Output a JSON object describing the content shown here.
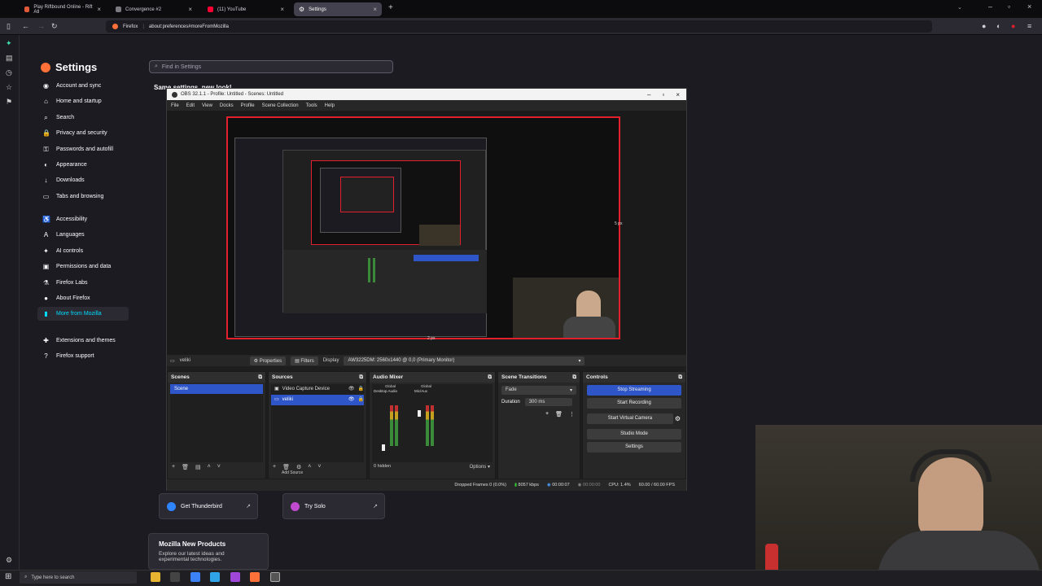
{
  "browser": {
    "tabs": [
      {
        "label": "Play Riftbound Online - Rift Atl",
        "color": "#e05a3a"
      },
      {
        "label": "Convergence #2",
        "color": "#7a7a80"
      },
      {
        "label": "(11) YouTube",
        "color": "#ff0033"
      },
      {
        "label": "Settings",
        "color": "#9a9aa5"
      }
    ],
    "new_tab": "+",
    "url_prefix": "Firefox",
    "url": "about:preferences#moreFromMozilla"
  },
  "settings": {
    "title": "Settings",
    "find_placeholder": "Find in Settings",
    "nav": [
      {
        "label": "Account and sync",
        "icon": "account-icon"
      },
      {
        "label": "Home and startup",
        "icon": "home-icon"
      },
      {
        "label": "Search",
        "icon": "search-icon"
      },
      {
        "label": "Privacy and security",
        "icon": "lock-icon"
      },
      {
        "label": "Passwords and autofill",
        "icon": "key-icon"
      },
      {
        "label": "Appearance",
        "icon": "palette-icon"
      },
      {
        "label": "Downloads",
        "icon": "download-icon"
      },
      {
        "label": "Tabs and browsing",
        "icon": "tabs-icon"
      }
    ],
    "nav2": [
      {
        "label": "Accessibility",
        "icon": "accessibility-icon"
      },
      {
        "label": "Languages",
        "icon": "language-icon"
      },
      {
        "label": "AI controls",
        "icon": "ai-icon"
      },
      {
        "label": "Permissions and data",
        "icon": "permissions-icon"
      },
      {
        "label": "Firefox Labs",
        "icon": "flask-icon"
      },
      {
        "label": "About Firefox",
        "icon": "firefox-icon"
      },
      {
        "label": "More from Mozilla",
        "icon": "mozilla-icon"
      }
    ],
    "nav3": [
      {
        "label": "Extensions and themes",
        "icon": "puzzle-icon"
      },
      {
        "label": "Firefox support",
        "icon": "help-icon"
      }
    ],
    "banner_title": "Same settings, new look!",
    "card_thunderbird": "Get Thunderbird",
    "card_solo": "Try Solo",
    "new_products_title": "Mozilla New Products",
    "new_products_desc_1": "Explore our latest ideas and",
    "new_products_desc_2": "experimental technologies."
  },
  "obs": {
    "title": "OBS 32.1.1 - Profile: Untitled - Scenes: Untitled",
    "menu": [
      "File",
      "Edit",
      "View",
      "Docks",
      "Profile",
      "Scene Collection",
      "Tools",
      "Help"
    ],
    "preview_label_right": "5 px",
    "preview_label_bottom": "2 px",
    "source_name": "veliki",
    "properties": "Properties",
    "filters": "Filters",
    "display_label": "Display",
    "display_value": "AW3225DM: 2560x1440 @ 0,0 (Primary Monitor)",
    "scenes_title": "Scenes",
    "scene_item": "Scene",
    "sources_title": "Sources",
    "sources": [
      "Video Capture Device",
      "veliki"
    ],
    "add_source_tooltip": "Add Source",
    "mixer_title": "Audio Mixer",
    "mixer_channels": [
      "Desktop Audio",
      "Mic/Aux"
    ],
    "mixer_global": "Global",
    "mixer_hidden": "0 hidden",
    "mixer_options": "Options",
    "transitions_title": "Scene Transitions",
    "transition_value": "Fade",
    "duration_label": "Duration",
    "duration_value": "300 ms",
    "controls_title": "Controls",
    "controls": [
      "Stop Streaming",
      "Start Recording",
      "Start Virtual Camera",
      "Studio Mode",
      "Settings"
    ],
    "status": {
      "dropped": "Dropped Frames 0 (0.0%)",
      "bitrate": "8057 kbps",
      "stream_time": "00:00:07",
      "rec_time": "00:00:00",
      "cpu": "CPU: 1.4%",
      "fps": "60.00 / 60.00 FPS"
    }
  },
  "taskbar": {
    "search_placeholder": "Type here to search"
  }
}
